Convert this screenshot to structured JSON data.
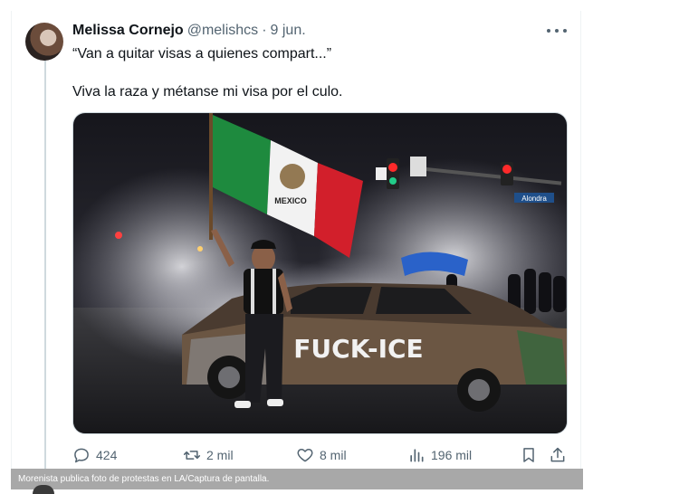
{
  "tweet": {
    "author_name": "Melissa Cornejo",
    "handle": "@melishcs",
    "separator": "·",
    "date": "9 jun.",
    "text_line_1": "“Van a quitar visas a quienes compart...”",
    "text_line_2": "Viva la raza y métanse mi visa por el culo."
  },
  "media": {
    "flag_label": "MEXICO",
    "car_graffiti": "FUCK-ICE",
    "street_sign": "Alondra"
  },
  "actions": {
    "replies": "424",
    "reposts": "2 mil",
    "likes": "8 mil",
    "views": "196 mil"
  },
  "caption": "Morenista publica foto de protestas en LA/Captura de pantalla.",
  "colors": {
    "text_primary": "#0f1419",
    "text_secondary": "#536471",
    "flag_green": "#1e8a3e",
    "flag_red": "#d21f2b",
    "caption_bg": "#a8a8a8"
  }
}
